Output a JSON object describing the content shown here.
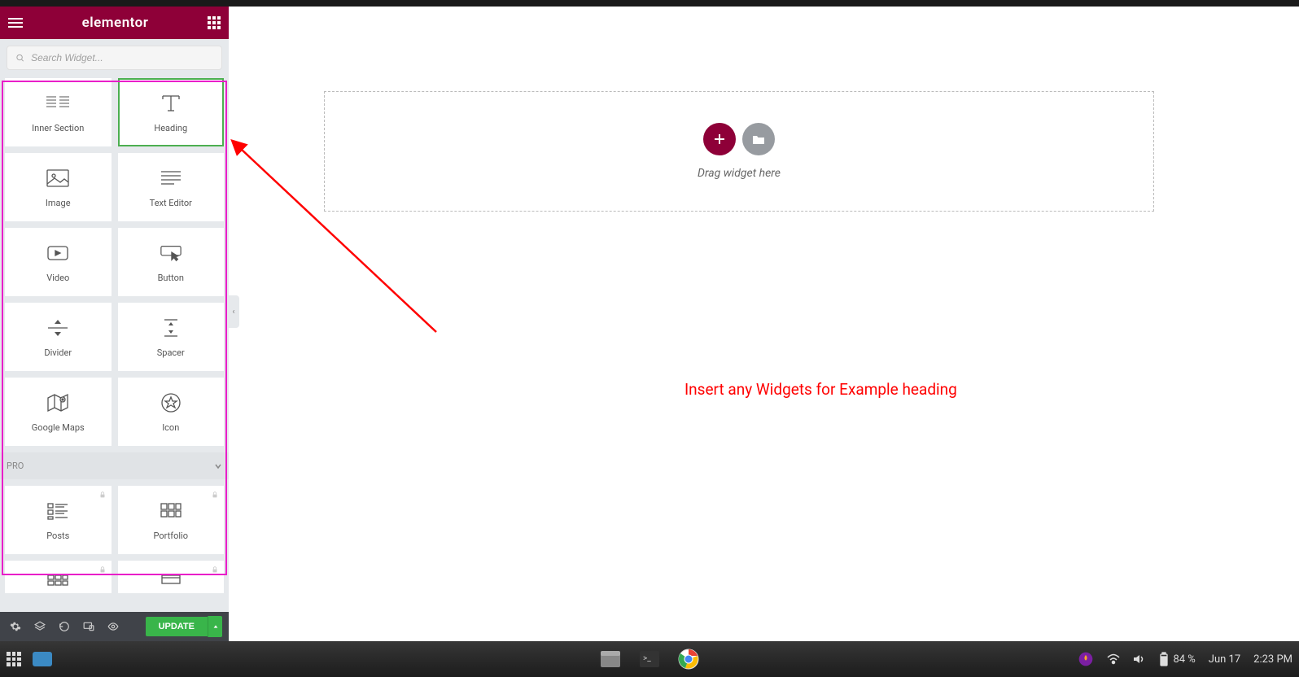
{
  "brand": "elementor",
  "search": {
    "placeholder": "Search Widget..."
  },
  "widgets": {
    "basic": {
      "inner_section": "Inner Section",
      "heading": "Heading",
      "image": "Image",
      "text_editor": "Text Editor",
      "video": "Video",
      "button": "Button",
      "divider": "Divider",
      "spacer": "Spacer",
      "google_maps": "Google Maps",
      "icon": "Icon"
    },
    "pro_label": "PRO",
    "pro": {
      "posts": "Posts",
      "portfolio": "Portfolio"
    }
  },
  "footer": {
    "update": "UPDATE"
  },
  "canvas": {
    "drop_text": "Drag widget here"
  },
  "annotation": {
    "text": "Insert any Widgets for Example heading"
  },
  "system_tray": {
    "battery": "84 %",
    "date": "Jun 17",
    "time": "2:23 PM"
  }
}
